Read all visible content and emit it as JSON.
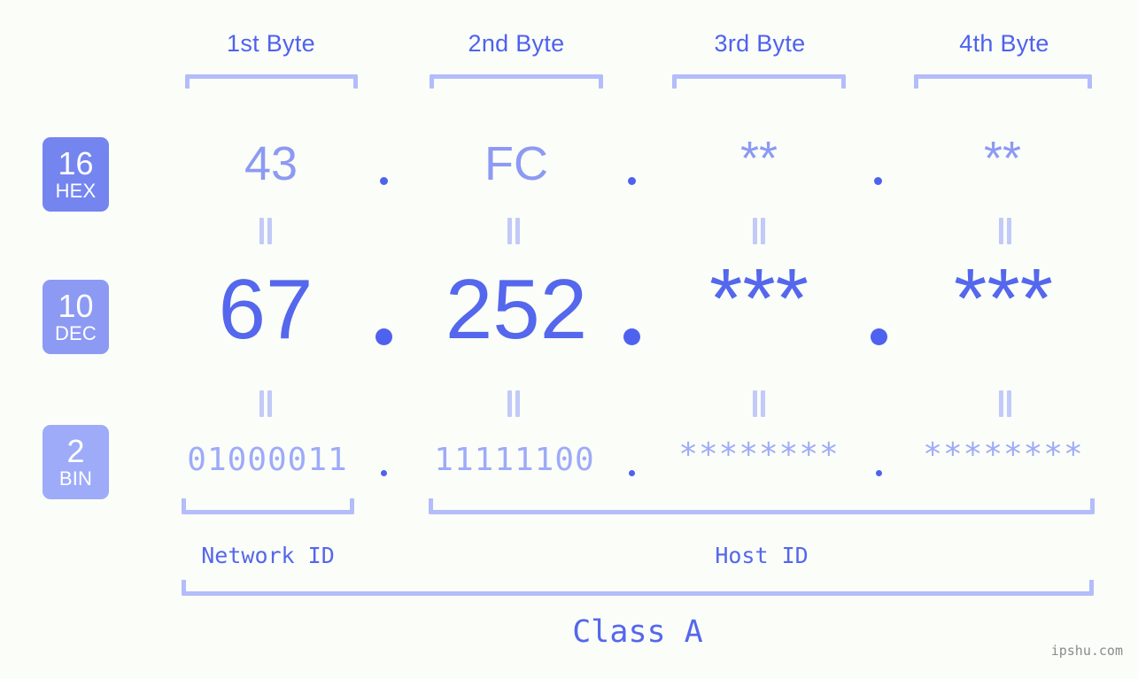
{
  "meta": {
    "background_color": "#fbfdf8",
    "accent_color": "#4e62ef",
    "bracket_color": "#b3bdfb",
    "watermark": "ipshu.com"
  },
  "byte_headers": [
    {
      "label": "1st Byte"
    },
    {
      "label": "2nd Byte"
    },
    {
      "label": "3rd Byte"
    },
    {
      "label": "4th Byte"
    }
  ],
  "rows": [
    {
      "badge_number": "16",
      "badge_label": "HEX",
      "badge_color": "#7485ef",
      "values": [
        "43",
        "FC",
        "**",
        "**"
      ],
      "separator": "."
    },
    {
      "badge_number": "10",
      "badge_label": "DEC",
      "badge_color": "#8c9af3",
      "values": [
        "67",
        "252",
        "***",
        "***"
      ],
      "separator": "."
    },
    {
      "badge_number": "2",
      "badge_label": "BIN",
      "badge_color": "#9dabf9",
      "values": [
        "01000011",
        "11111100",
        "********",
        "********"
      ],
      "separator": "."
    }
  ],
  "equals_marks": {
    "glyph": "||"
  },
  "sections": [
    {
      "label": "Network ID"
    },
    {
      "label": "Host ID"
    }
  ],
  "class": {
    "label": "Class A"
  }
}
